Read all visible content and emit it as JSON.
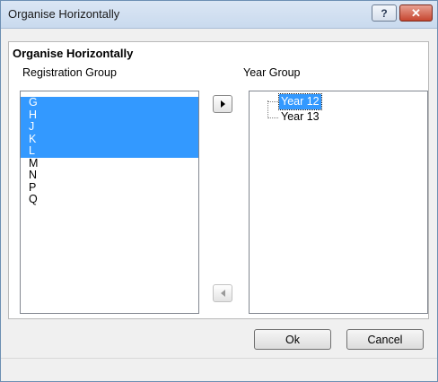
{
  "window": {
    "title": "Organise Horizontally",
    "help_label": "?",
    "close_label": "✕"
  },
  "dialog": {
    "heading": "Organise Horizontally",
    "registration_label": "Registration Group",
    "year_label": "Year Group",
    "registration_items": [
      {
        "label": "G",
        "selected": true
      },
      {
        "label": "H",
        "selected": true
      },
      {
        "label": "J",
        "selected": true
      },
      {
        "label": "K",
        "selected": true
      },
      {
        "label": "L",
        "selected": true
      },
      {
        "label": "M",
        "selected": false
      },
      {
        "label": "N",
        "selected": false
      },
      {
        "label": "P",
        "selected": false
      },
      {
        "label": "Q",
        "selected": false
      }
    ],
    "year_items": [
      {
        "label": "Year 12",
        "selected": true
      },
      {
        "label": "Year 13",
        "selected": false
      }
    ]
  },
  "buttons": {
    "ok": "Ok",
    "cancel": "Cancel"
  },
  "colors": {
    "selection": "#3399ff",
    "close_button": "#c6462f"
  },
  "icons": {
    "move_right": "triangle-right-icon",
    "move_left": "triangle-left-icon"
  }
}
